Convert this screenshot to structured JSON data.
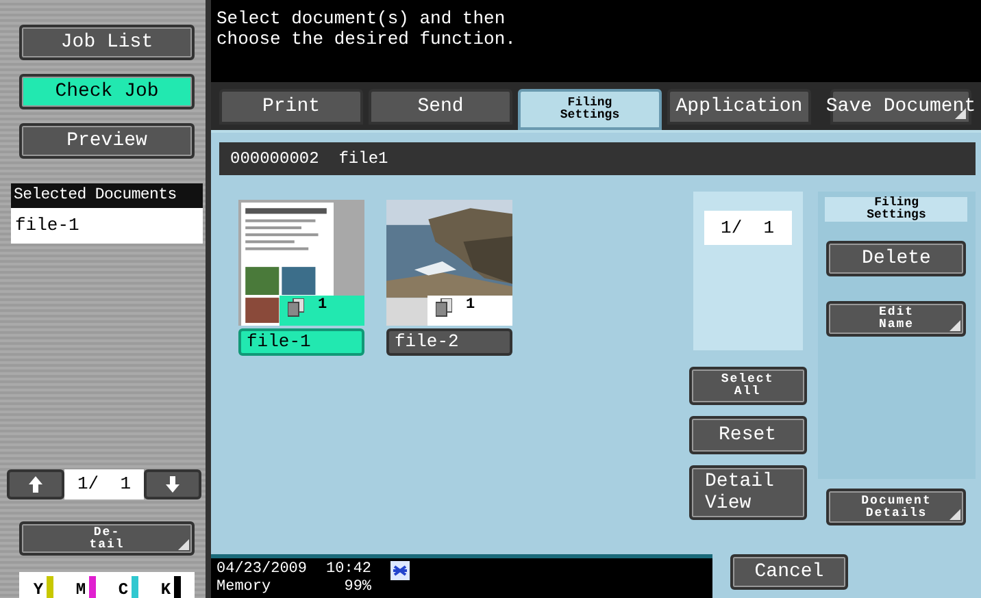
{
  "sidebar": {
    "buttons": [
      {
        "label": "Job List",
        "selected": false
      },
      {
        "label": "Check Job",
        "selected": true
      },
      {
        "label": "Preview",
        "selected": false
      }
    ],
    "selected_documents": {
      "title": "Selected Documents",
      "items": [
        "file-1"
      ]
    },
    "pager": {
      "page": "1/  1"
    },
    "detail_button": {
      "label": "De-\ntail",
      "corner": true
    },
    "toner": [
      {
        "label": "Y",
        "color": "#c8c800"
      },
      {
        "label": "M",
        "color": "#e020d0"
      },
      {
        "label": "C",
        "color": "#30c8d0"
      },
      {
        "label": "K",
        "color": "#000000"
      }
    ]
  },
  "message": "Select document(s) and then\nchoose the desired function.",
  "tabs": [
    {
      "label": "Print",
      "selected": false,
      "kind": "regular",
      "corner": false
    },
    {
      "label": "Send",
      "selected": false,
      "kind": "regular",
      "corner": false
    },
    {
      "label": "Filing\nSettings",
      "selected": true,
      "kind": "compact",
      "corner": false
    },
    {
      "label": "Application",
      "selected": false,
      "kind": "regular",
      "corner": false
    },
    {
      "label": "Save Document",
      "selected": false,
      "kind": "regular",
      "corner": true
    }
  ],
  "box": {
    "number": "000000002",
    "name": "file1"
  },
  "thumbnails": [
    {
      "name": "file-1",
      "count": "1",
      "selected": true,
      "kind": "document"
    },
    {
      "name": "file-2",
      "count": "1",
      "selected": false
    }
  ],
  "page_counter": "1/  1",
  "actions": [
    {
      "label": "Select\nAll",
      "kind": "compact"
    },
    {
      "label": "Reset",
      "kind": "regular"
    },
    {
      "label": "Detail\nView",
      "kind": "regular"
    }
  ],
  "filing_panel": {
    "title": "Filing\nSettings",
    "buttons": [
      {
        "label": "Delete",
        "kind": "regular",
        "corner": false
      },
      {
        "label": "Edit\nName",
        "kind": "compact",
        "corner": true
      }
    ]
  },
  "document_details": {
    "label": "Document\nDetails",
    "kind": "compact",
    "corner": true
  },
  "status": {
    "date": "04/23/2009",
    "time": "10:42",
    "memory_label": "Memory",
    "memory": "99%"
  },
  "cancel": "Cancel"
}
